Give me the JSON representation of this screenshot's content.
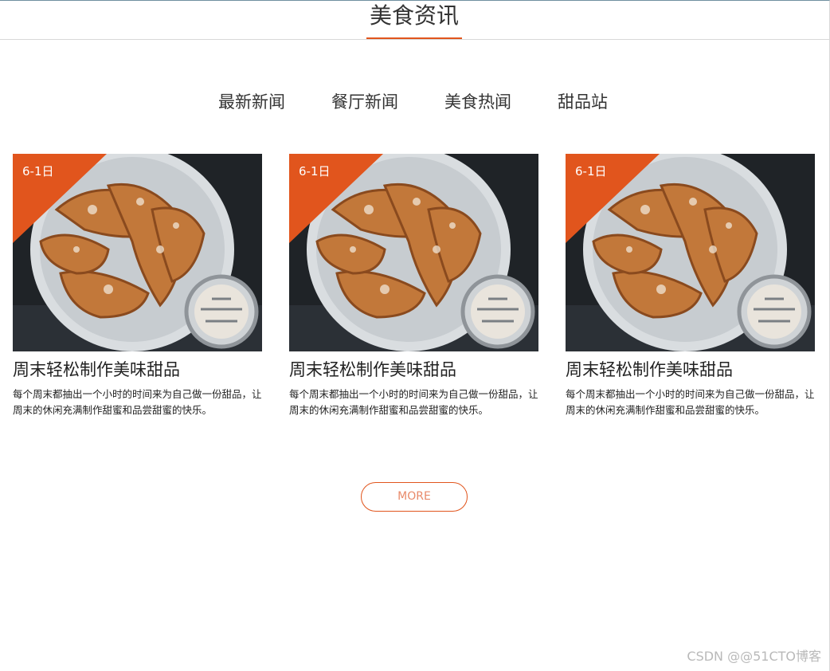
{
  "section": {
    "title": "美食资讯"
  },
  "tabs": [
    {
      "label": "最新新闻"
    },
    {
      "label": "餐厅新闻"
    },
    {
      "label": "美食热闻"
    },
    {
      "label": "甜品站"
    }
  ],
  "cards": [
    {
      "date": "6-1日",
      "title": "周末轻松制作美味甜品",
      "description": "每个周末都抽出一个小时的时间来为自己做一份甜品，让周末的休闲充满制作甜蜜和品尝甜蜜的快乐。",
      "image_icon": "pastry-photo"
    },
    {
      "date": "6-1日",
      "title": "周末轻松制作美味甜品",
      "description": "每个周末都抽出一个小时的时间来为自己做一份甜品，让周末的休闲充满制作甜蜜和品尝甜蜜的快乐。",
      "image_icon": "pastry-photo"
    },
    {
      "date": "6-1日",
      "title": "周末轻松制作美味甜品",
      "description": "每个周末都抽出一个小时的时间来为自己做一份甜品，让周末的休闲充满制作甜蜜和品尝甜蜜的快乐。",
      "image_icon": "pastry-photo"
    }
  ],
  "more_button": {
    "label": "MORE"
  },
  "watermark": {
    "text": "CSDN @@51CTO博客"
  },
  "colors": {
    "accent": "#e1551d",
    "text": "#333333",
    "more_text": "#e88a6a"
  }
}
